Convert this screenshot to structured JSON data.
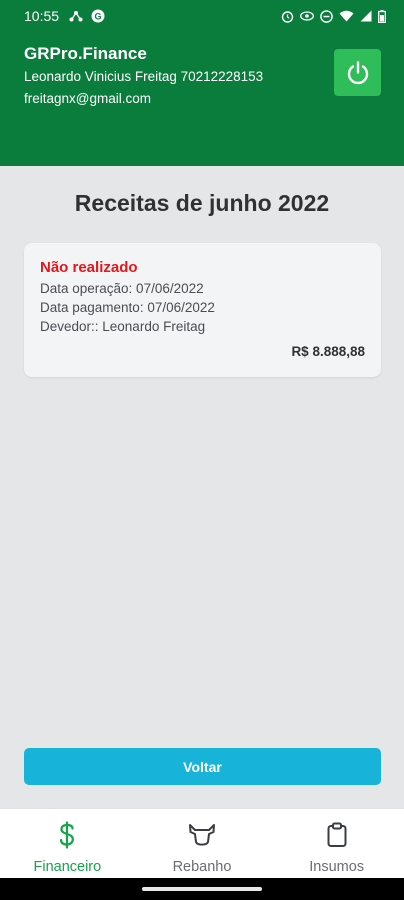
{
  "status_bar": {
    "time": "10:55"
  },
  "header": {
    "app_title": "GRPro.Finance",
    "user_line": "Leonardo Vinicius Freitag 70212228153",
    "email": "freitagnx@gmail.com"
  },
  "page": {
    "title": "Receitas de junho 2022"
  },
  "receipts": [
    {
      "status": "Não realizado",
      "operation_date": "Data operação: 07/06/2022",
      "payment_date": "Data pagamento: 07/06/2022",
      "debtor": "Devedor:: Leonardo Freitag",
      "amount": "R$ 8.888,88"
    }
  ],
  "actions": {
    "back_label": "Voltar"
  },
  "bottom_nav": {
    "items": [
      {
        "label": "Financeiro",
        "icon": "dollar-icon",
        "active": true
      },
      {
        "label": "Rebanho",
        "icon": "cow-icon",
        "active": false
      },
      {
        "label": "Insumos",
        "icon": "clipboard-icon",
        "active": false
      }
    ]
  },
  "colors": {
    "header_bg": "#0a7d3c",
    "power_button": "#2fbd5a",
    "status_not_done": "#e5161b",
    "back_button": "#18b3d8",
    "nav_active": "#17a34a"
  }
}
